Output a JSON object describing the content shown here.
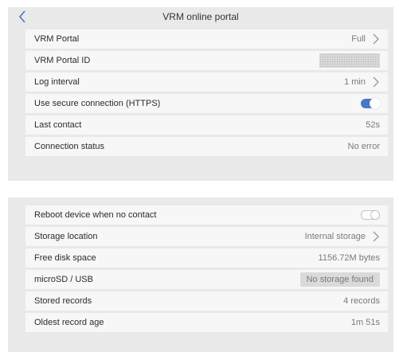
{
  "header": {
    "title": "VRM online portal"
  },
  "rows_top": [
    {
      "label": "VRM Portal",
      "value": "Full"
    },
    {
      "label": "VRM Portal ID"
    },
    {
      "label": "Log interval",
      "value": "1 min"
    },
    {
      "label": "Use secure connection (HTTPS)",
      "toggle": "on"
    },
    {
      "label": "Last contact",
      "value": "52s"
    },
    {
      "label": "Connection status",
      "value": "No error"
    }
  ],
  "rows_bottom": [
    {
      "label": "Reboot device when no contact",
      "toggle": "off"
    },
    {
      "label": "Storage location",
      "value": "Internal storage"
    },
    {
      "label": "Free disk space",
      "value": "1156.72M bytes"
    },
    {
      "label": "microSD / USB",
      "value": "No storage found"
    },
    {
      "label": "Stored records",
      "value": "4 records"
    },
    {
      "label": "Oldest record age",
      "value": "1m 51s"
    }
  ],
  "colors": {
    "accent": "#4a78c7",
    "panel": "#e9e9ea",
    "row": "#f7f7f7"
  },
  "icons": {
    "back": "chevron-left-icon",
    "next": "chevron-right-icon"
  }
}
